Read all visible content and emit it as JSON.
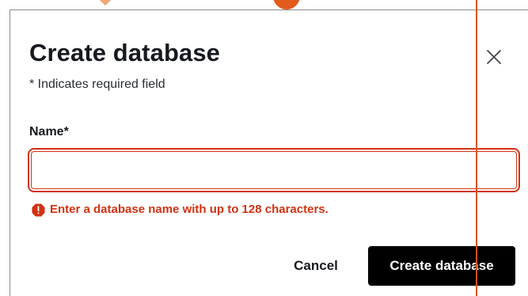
{
  "modal": {
    "title": "Create database",
    "required_note": "* Indicates required field",
    "close_icon": "close-icon"
  },
  "form": {
    "name_label": "Name*",
    "name_value": "",
    "error_message": "Enter a database name with up to 128 characters.",
    "error_icon": "error-octagon-icon"
  },
  "actions": {
    "cancel_label": "Cancel",
    "create_label": "Create database"
  },
  "colors": {
    "error": "#d13212",
    "primary_button": "#000000",
    "title_text": "#16191f",
    "accent": "#e25a1c"
  }
}
